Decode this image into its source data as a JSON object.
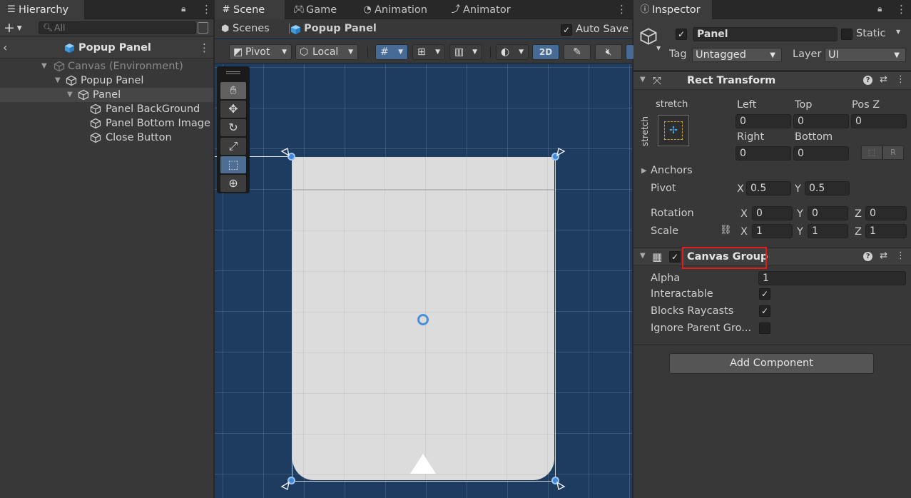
{
  "hierarchy": {
    "tab_label": "Hierarchy",
    "search_placeholder": "All",
    "header_title": "Popup Panel",
    "tree": [
      {
        "label": "Canvas (Environment)"
      },
      {
        "label": "Popup Panel"
      },
      {
        "label": "Panel"
      },
      {
        "label": "Panel BackGround"
      },
      {
        "label": "Panel Bottom Image"
      },
      {
        "label": "Close Button"
      }
    ]
  },
  "scene": {
    "tabs": [
      "Scene",
      "Game",
      "Animation",
      "Animator"
    ],
    "breadcrumb": [
      "Scenes",
      "Popup Panel"
    ],
    "auto_save_label": "Auto Save",
    "pivot_label": "Pivot",
    "local_label": "Local",
    "mode_2d_label": "2D"
  },
  "inspector": {
    "tab_label": "Inspector",
    "object_name": "Panel",
    "static_label": "Static",
    "tag_label": "Tag",
    "tag_value": "Untagged",
    "layer_label": "Layer",
    "layer_value": "UI",
    "rect_transform": {
      "title": "Rect Transform",
      "stretch_h": "stretch",
      "stretch_v": "stretch",
      "left_label": "Left",
      "left_value": "0",
      "top_label": "Top",
      "top_value": "0",
      "posz_label": "Pos Z",
      "posz_value": "0",
      "right_label": "Right",
      "right_value": "0",
      "bottom_label": "Bottom",
      "bottom_value": "0",
      "anchors_label": "Anchors",
      "pivot_label": "Pivot",
      "pivot_x": "0.5",
      "pivot_y": "0.5",
      "rotation_label": "Rotation",
      "rot_x": "0",
      "rot_y": "0",
      "rot_z": "0",
      "scale_label": "Scale",
      "scale_x": "1",
      "scale_y": "1",
      "scale_z": "1",
      "axis_x": "X",
      "axis_y": "Y",
      "axis_z": "Z",
      "raw_btn": "R"
    },
    "canvas_group": {
      "title": "Canvas Group",
      "alpha_label": "Alpha",
      "alpha_value": "1",
      "interactable_label": "Interactable",
      "blocks_label": "Blocks Raycasts",
      "ignore_label": "Ignore Parent Gro..."
    },
    "add_component_label": "Add Component"
  },
  "colors": {
    "selection_highlight": "#e01c1c",
    "scene_background": "#1d3c5f",
    "handle_blue": "#3f88e0"
  }
}
